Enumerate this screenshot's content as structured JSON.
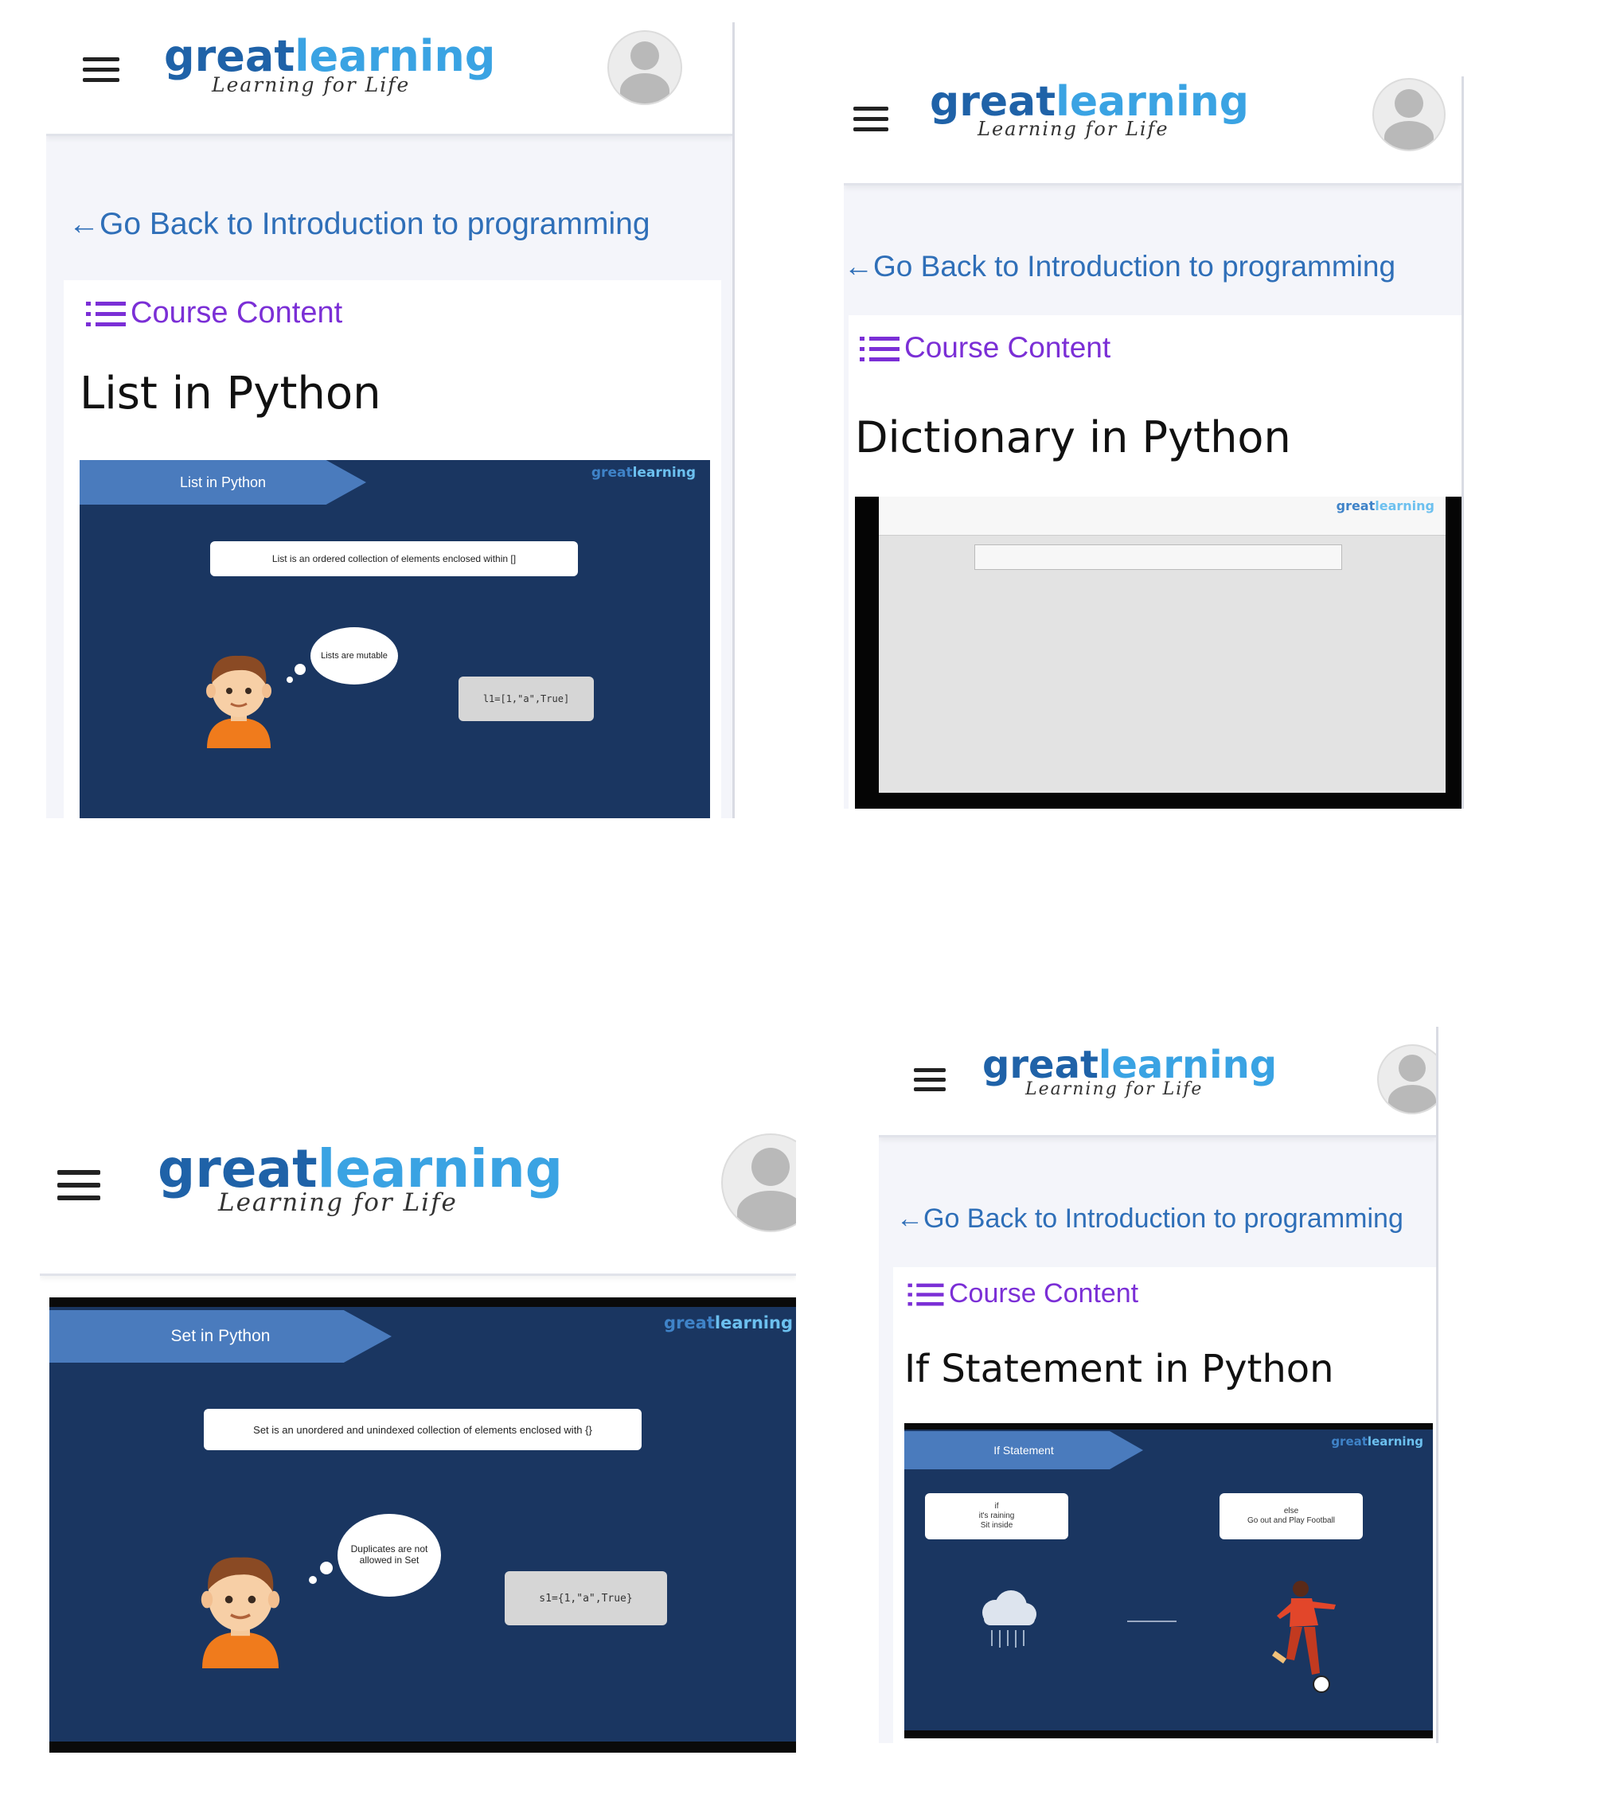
{
  "app": {
    "logo_main_a": "great",
    "logo_main_b": "learning",
    "logo_sub": "Learning for Life",
    "back_arrow": "←",
    "back_link": "Go Back to Introduction to programming",
    "course_content": "Course Content"
  },
  "panels": {
    "list": {
      "title": "List in Python",
      "ribbon": "List in Python",
      "slide_logo_a": "great",
      "slide_logo_b": "learning",
      "definition": "List is an ordered collection of elements enclosed within []",
      "bubble": "Lists are mutable",
      "code": "l1=[1,\"a\",True]"
    },
    "dict": {
      "title": "Dictionary in Python",
      "slide_logo_a": "great",
      "slide_logo_b": "learning"
    },
    "set": {
      "ribbon": "Set in Python",
      "slide_logo_a": "great",
      "slide_logo_b": "learning",
      "definition": "Set is an unordered and unindexed collection of elements enclosed with {}",
      "bubble": "Duplicates are not allowed in Set",
      "code": "s1={1,\"a\",True}"
    },
    "if": {
      "title": "If Statement in Python",
      "ribbon": "If Statement",
      "slide_logo_a": "great",
      "slide_logo_b": "learning",
      "if_text_1": "if",
      "if_text_2": "it's raining",
      "if_text_3": "Sit inside",
      "else_text_1": "else",
      "else_text_2": "Go out and Play Football"
    }
  },
  "colors": {
    "brand_dark": "#1f62a8",
    "brand_light": "#3aa3e3",
    "link": "#2f6fb8",
    "course_content": "#7b2fd6",
    "slide_bg": "#1a3661",
    "ribbon": "#4a7bbd"
  },
  "icons": [
    "menu-icon",
    "avatar-icon",
    "back-arrow-icon",
    "list-icon",
    "cloud-rain-icon",
    "football-player-icon"
  ]
}
